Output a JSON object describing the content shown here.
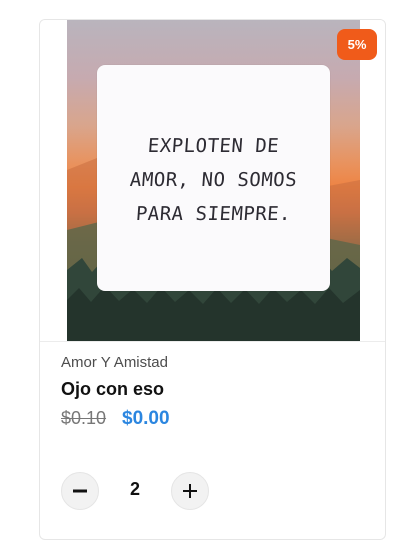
{
  "product": {
    "discount_badge": "5%",
    "image_note": {
      "lines": [
        "EXPLOTEN DE",
        "AMOR, NO SOMOS",
        "PARA SIEMPRE."
      ]
    },
    "category": "Amor Y Amistad",
    "title": "Ojo con eso",
    "price_original": "$0.10",
    "price_current": "$0.00",
    "quantity": "2",
    "icons": {
      "decrease": "minus-icon",
      "increase": "plus-icon"
    }
  },
  "colors": {
    "badge": "#f05b1a",
    "price_current": "#2b86e0"
  }
}
